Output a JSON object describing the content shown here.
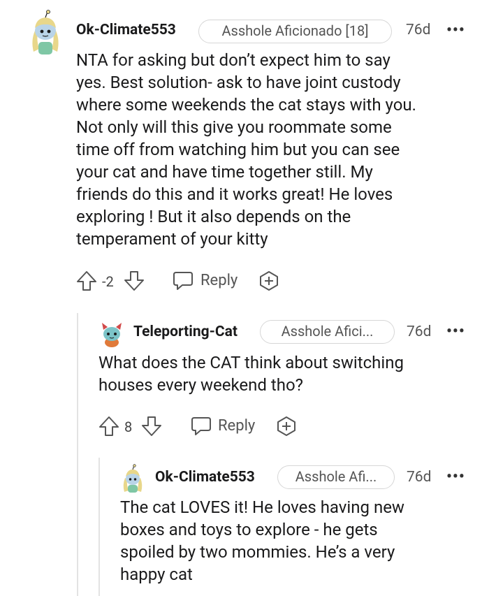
{
  "comments": [
    {
      "username": "Ok-Climate553",
      "flair": "Asshole Aficionado [18]",
      "age": "76d",
      "more": "•••",
      "body_lines": [
        "NTA for asking but don’t expect him to say",
        "yes. Best solution- ask to have joint custody",
        "where some weekends the cat stays with you.",
        "Not only will this give you roommate some",
        "time off from watching him but you can see",
        "your cat and have time together still. My",
        "friends do this and it works great! He loves",
        "exploring ! But it also depends on the",
        "temperament of your kitty"
      ],
      "score": "-2",
      "reply_label": "Reply"
    },
    {
      "username": "Teleporting-Cat",
      "flair": "Asshole Afici...",
      "age": "76d",
      "more": "•••",
      "body_lines": [
        "What does the CAT think about switching",
        "houses every weekend tho?"
      ],
      "score": "8",
      "reply_label": "Reply"
    },
    {
      "username": "Ok-Climate553",
      "flair": "Asshole Afi...",
      "age": "76d",
      "more": "•••",
      "body_lines": [
        "The cat LOVES it! He loves having new",
        "boxes and toys to explore - he gets",
        "spoiled by two mommies. He’s a very",
        "happy cat"
      ]
    }
  ],
  "icons": {
    "upvote": "upvote-arrow-icon",
    "downvote": "downvote-arrow-icon",
    "reply": "speech-bubble-icon",
    "award": "add-award-icon",
    "avatar_1": "snoo-avatar-icon",
    "avatar_2": "snoo-avatar-icon",
    "avatar_3": "snoo-avatar-icon"
  },
  "colors": {
    "text": "#1a1a1b",
    "meta": "#555555",
    "icon": "#555555",
    "thread_line": "#e3e3e3",
    "flair_border": "#d6d6d6"
  }
}
